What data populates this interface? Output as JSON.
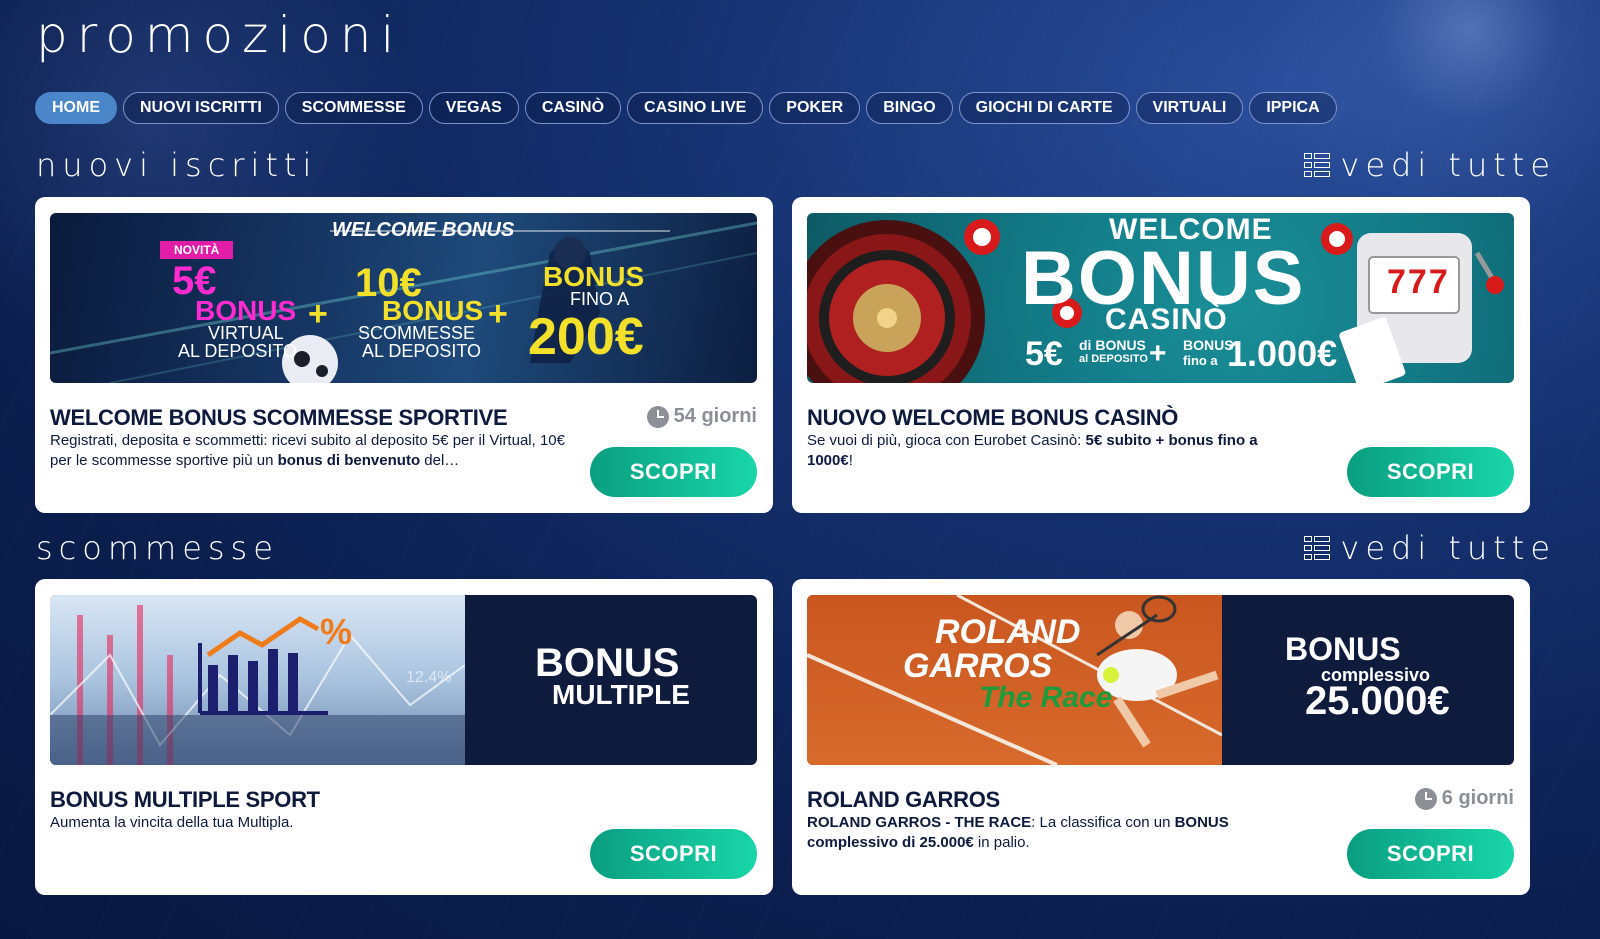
{
  "page_title": "promozioni",
  "tabs": [
    {
      "label": "HOME",
      "active": true
    },
    {
      "label": "NUOVI ISCRITTI"
    },
    {
      "label": "SCOMMESSE"
    },
    {
      "label": "VEGAS"
    },
    {
      "label": "CASINÒ"
    },
    {
      "label": "CASINO LIVE"
    },
    {
      "label": "POKER"
    },
    {
      "label": "BINGO"
    },
    {
      "label": "GIOCHI DI CARTE"
    },
    {
      "label": "VIRTUALI"
    },
    {
      "label": "IPPICA"
    }
  ],
  "see_all_label": "vedi tutte",
  "sections": [
    {
      "title": "nuovi iscritti",
      "cards": [
        {
          "title": "WELCOME BONUS SCOMMESSE SPORTIVE",
          "days": "54 giorni",
          "desc_1": "Registrati, deposita e scommetti: ricevi subito al deposito 5€ per il Virtual, 10€ per le scommesse sportive più un ",
          "desc_bold": "bonus di benvenuto",
          "desc_2": " del…",
          "button": "SCOPRI",
          "banner": {
            "header": "WELCOME BONUS",
            "badge": "NOVITÀ",
            "a_amount": "5€",
            "a_word": "BONUS",
            "a_l1": "VIRTUAL",
            "a_l2": "AL DEPOSITO",
            "plus": "+",
            "b_amount": "10€",
            "b_word": "BONUS",
            "b_l1": "SCOMMESSE",
            "b_l2": "AL DEPOSITO",
            "c_word": "BONUS",
            "c_l1": "FINO A",
            "c_amount": "200€"
          }
        },
        {
          "title": "NUOVO WELCOME BONUS CASINÒ",
          "desc_1": "Se vuoi di più, gioca con Eurobet Casinò: ",
          "desc_bold": "5€ subito + bonus fino a 1000€",
          "desc_2": "!",
          "button": "SCOPRI",
          "banner": {
            "l1": "WELCOME",
            "l2": "BONUS",
            "l3": "CASINÒ",
            "a_amount": "5€",
            "a_small1": "di BONUS",
            "a_small2": "al DEPOSITO",
            "plus": "+",
            "b_small1": "BONUS",
            "b_small2": "fino a",
            "b_amount": "1.000€",
            "slot": "777"
          }
        }
      ]
    },
    {
      "title": "scommesse",
      "cards": [
        {
          "title": "BONUS MULTIPLE SPORT",
          "desc_1": "Aumenta la vincita della tua Multipla.",
          "button": "SCOPRI",
          "banner": {
            "l1": "BONUS",
            "l2": "MULTIPLE",
            "pct": "%",
            "stat": "12.4%"
          }
        },
        {
          "title": "ROLAND GARROS",
          "days": "6 giorni",
          "desc_bold_1": "ROLAND GARROS - THE RACE",
          "desc_1": ": La classifica con un ",
          "desc_bold_2": "BONUS complessivo di 25.000€",
          "desc_2": " in palio.",
          "button": "SCOPRI",
          "banner": {
            "l1": "ROLAND",
            "l2": "GARROS",
            "l3": "The Race",
            "r1": "BONUS",
            "r2": "complessivo",
            "r3": "25.000€"
          }
        }
      ]
    }
  ],
  "colors": {
    "accent_tab": "#4a86c8",
    "button_start": "#0a9e80",
    "button_end": "#19d6a9",
    "title_text": "#0e1a3c"
  }
}
